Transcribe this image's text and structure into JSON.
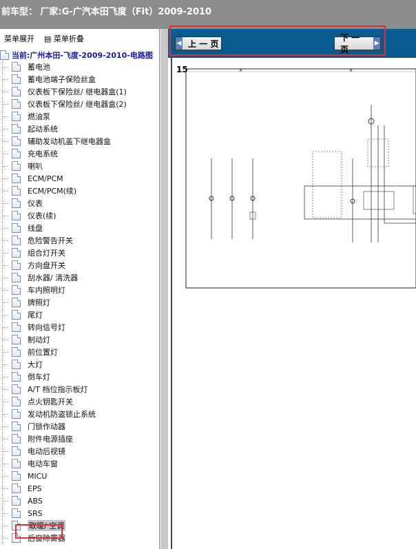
{
  "title": "前车型： 厂家:G-广汽本田飞度（Fit）2009-2010",
  "menu_controls": {
    "expand": "菜单展开",
    "collapse": "菜单折叠"
  },
  "current": "当前:广州本田-飞度-2009-2010-电路图",
  "items": [
    "蓄电池",
    "蓄电池端子保险丝盒",
    "仪表板下保险丝/ 继电器盒(1)",
    "仪表板下保险丝/ 继电器盒(2)",
    "燃油泵",
    "起动系统",
    "辅助发动机盖下继电器盒",
    "充电系统",
    "喇叭",
    "ECM/PCM",
    "ECM/PCM(续)",
    "仪表",
    "仪表(续)",
    "线盘",
    "危险警告开关",
    "组合灯开关",
    "方向盘开关",
    "刮水器/ 清洗器",
    "车内照明灯",
    "牌照灯",
    "尾灯",
    "转向信号灯",
    "制动灯",
    "前位置灯",
    "大灯",
    "倒车灯",
    "A/T 档位指示板灯",
    "点火钥匙开关",
    "发动机防盗锁止系统",
    "门锁作动器",
    "附件电源插座",
    "电动后视镜",
    "电动车窗",
    "MICU",
    "EPS",
    "ABS",
    "SRS",
    "取暖/ 空调",
    "后窗除雾器"
  ],
  "selected_index": 37,
  "nav": {
    "prev": "上 一 页",
    "next": "下 一 页"
  },
  "page_number": "15",
  "colors": {
    "title_bg": "#8c8c8c",
    "nav_bg": "#0b5a8f",
    "highlight": "#e03030"
  }
}
